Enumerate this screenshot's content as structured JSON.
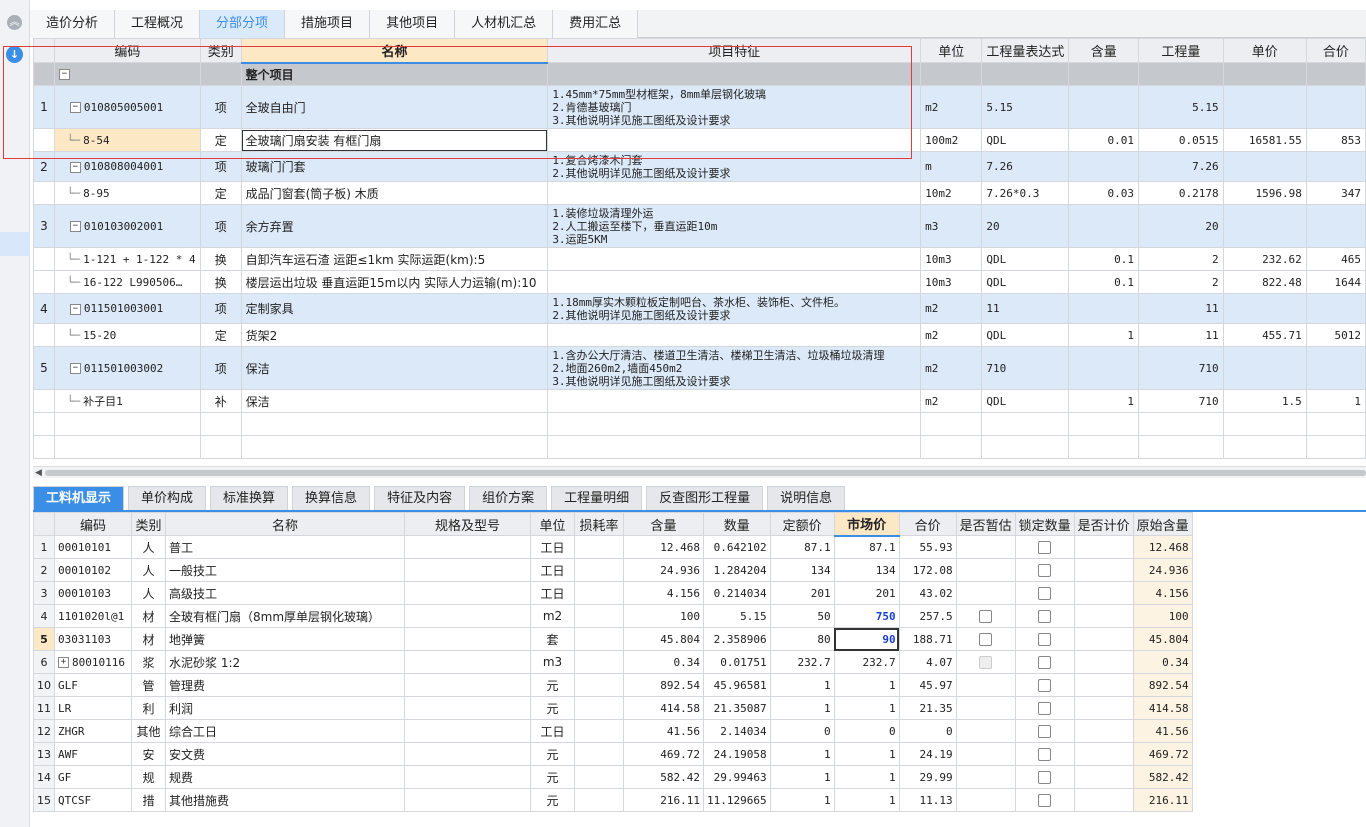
{
  "top_tabs": [
    "造价分析",
    "工程概况",
    "分部分项",
    "措施项目",
    "其他项目",
    "人材机汇总",
    "费用汇总"
  ],
  "top_active": 2,
  "upper_headers": [
    "编码",
    "类别",
    "名称",
    "项目特征",
    "单位",
    "工程量表达式",
    "含量",
    "工程量",
    "单价",
    "合价"
  ],
  "upper_rows": [
    {
      "type": "grp",
      "rn": "",
      "code": "",
      "cat": "",
      "name": "整个项目",
      "feat": "",
      "unit": "",
      "expr": "",
      "qty_ratio": "",
      "qty": "",
      "price": "",
      "total": ""
    },
    {
      "type": "item",
      "rn": "1",
      "code": "010805005001",
      "cat": "项",
      "name": "全玻自由门",
      "feat": "1.45mm*75mm型材框架，8mm单层钢化玻璃\n2.肯德基玻璃门\n3.其他说明详见施工图纸及设计要求",
      "unit": "m2",
      "expr": "5.15",
      "qty_ratio": "",
      "qty": "5.15",
      "price": "",
      "total": ""
    },
    {
      "type": "sub",
      "rn": "",
      "code": "8-54",
      "cat": "定",
      "name": "全玻璃门扇安装 有框门扇",
      "feat": "",
      "unit": "100m2",
      "expr": "QDL",
      "qty_ratio": "0.01",
      "qty": "0.0515",
      "price": "16581.55",
      "total": "853"
    },
    {
      "type": "item",
      "rn": "2",
      "code": "010808004001",
      "cat": "项",
      "name": "玻璃门门套",
      "feat": "1.复合烤漆木门套\n2.其他说明详见施工图纸及设计要求",
      "unit": "m",
      "expr": "7.26",
      "qty_ratio": "",
      "qty": "7.26",
      "price": "",
      "total": ""
    },
    {
      "type": "sub",
      "rn": "",
      "code": "8-95",
      "cat": "定",
      "name": "成品门窗套(筒子板) 木质",
      "feat": "",
      "unit": "10m2",
      "expr": "7.26*0.3",
      "qty_ratio": "0.03",
      "qty": "0.2178",
      "price": "1596.98",
      "total": "347"
    },
    {
      "type": "item",
      "rn": "3",
      "code": "010103002001",
      "cat": "项",
      "name": "余方弃置",
      "feat": "1.装修垃圾清理外运\n2.人工搬运至楼下，垂直运距10m\n3.运距5KM",
      "unit": "m3",
      "expr": "20",
      "qty_ratio": "",
      "qty": "20",
      "price": "",
      "total": ""
    },
    {
      "type": "sub",
      "rn": "",
      "code": "1-121 + 1-122 * 4",
      "cat": "换",
      "name": "自卸汽车运石渣 运距≤1km  实际运距(km):5",
      "feat": "",
      "unit": "10m3",
      "expr": "QDL",
      "qty_ratio": "0.1",
      "qty": "2",
      "price": "232.62",
      "total": "465"
    },
    {
      "type": "sub",
      "rn": "",
      "code": "16-122 L990506…",
      "cat": "换",
      "name": "楼层运出垃圾 垂直运距15m以内  实际人力运输(m):10",
      "feat": "",
      "unit": "10m3",
      "expr": "QDL",
      "qty_ratio": "0.1",
      "qty": "2",
      "price": "822.48",
      "total": "1644"
    },
    {
      "type": "item",
      "rn": "4",
      "code": "011501003001",
      "cat": "项",
      "name": "定制家具",
      "feat": "1.18mm厚实木颗粒板定制吧台、茶水柜、装饰柜、文件柜。\n2.其他说明详见施工图纸及设计要求",
      "unit": "m2",
      "expr": "11",
      "qty_ratio": "",
      "qty": "11",
      "price": "",
      "total": ""
    },
    {
      "type": "sub",
      "rn": "",
      "code": "15-20",
      "cat": "定",
      "name": "货架2",
      "feat": "",
      "unit": "m2",
      "expr": "QDL",
      "qty_ratio": "1",
      "qty": "11",
      "price": "455.71",
      "total": "5012"
    },
    {
      "type": "item",
      "rn": "5",
      "code": "011501003002",
      "cat": "项",
      "name": "保洁",
      "feat": "1.含办公大厅清洁、楼道卫生清洁、楼梯卫生清洁、垃圾桶垃圾清理\n2.地面260m2,墙面450m2\n3.其他说明详见施工图纸及设计要求",
      "unit": "m2",
      "expr": "710",
      "qty_ratio": "",
      "qty": "710",
      "price": "",
      "total": ""
    },
    {
      "type": "sub",
      "rn": "",
      "code": "补子目1",
      "cat": "补",
      "name": "保洁",
      "feat": "",
      "unit": "m2",
      "expr": "QDL",
      "qty_ratio": "1",
      "qty": "710",
      "price": "1.5",
      "total": "1"
    }
  ],
  "bottom_tabs": [
    "工料机显示",
    "单价构成",
    "标准换算",
    "换算信息",
    "特征及内容",
    "组价方案",
    "工程量明细",
    "反查图形工程量",
    "说明信息"
  ],
  "bottom_active": 0,
  "lower_headers": [
    "编码",
    "类别",
    "名称",
    "规格及型号",
    "单位",
    "损耗率",
    "含量",
    "数量",
    "定额价",
    "市场价",
    "合价",
    "是否暂估",
    "锁定数量",
    "是否计价",
    "原始含量"
  ],
  "lower_rows": [
    {
      "rn": "1",
      "code": "00010101",
      "cat": "人",
      "name": "普工",
      "spec": "",
      "unit": "工日",
      "loss": "",
      "ratio": "12.468",
      "qty": "0.642102",
      "base": "87.1",
      "market": "87.1",
      "total": "55.93",
      "est": "",
      "lock": "cb",
      "calc": "",
      "orig": "12.468"
    },
    {
      "rn": "2",
      "code": "00010102",
      "cat": "人",
      "name": "一般技工",
      "spec": "",
      "unit": "工日",
      "loss": "",
      "ratio": "24.936",
      "qty": "1.284204",
      "base": "134",
      "market": "134",
      "total": "172.08",
      "est": "",
      "lock": "cb",
      "calc": "",
      "orig": "24.936"
    },
    {
      "rn": "3",
      "code": "00010103",
      "cat": "人",
      "name": "高级技工",
      "spec": "",
      "unit": "工日",
      "loss": "",
      "ratio": "4.156",
      "qty": "0.214034",
      "base": "201",
      "market": "201",
      "total": "43.02",
      "est": "",
      "lock": "cb",
      "calc": "",
      "orig": "4.156"
    },
    {
      "rn": "4",
      "code": "1101020l@1",
      "cat": "材",
      "name": "全玻有框门扇（8mm厚单层钢化玻璃）",
      "spec": "",
      "unit": "m2",
      "loss": "",
      "ratio": "100",
      "qty": "5.15",
      "base": "50",
      "market": "750",
      "total": "257.5",
      "est": "cb",
      "lock": "cb",
      "calc": "",
      "orig": "100",
      "blue": true
    },
    {
      "rn": "5",
      "code": "03031103",
      "cat": "材",
      "name": "地弹簧",
      "spec": "",
      "unit": "套",
      "loss": "",
      "ratio": "45.804",
      "qty": "2.358906",
      "base": "80",
      "market": "90",
      "total": "188.71",
      "est": "cb",
      "lock": "cb",
      "calc": "",
      "orig": "45.804",
      "blue": true,
      "current": true
    },
    {
      "rn": "6",
      "code": "80010116",
      "cat": "浆",
      "name": "水泥砂浆 1:2",
      "spec": "",
      "unit": "m3",
      "loss": "",
      "ratio": "0.34",
      "qty": "0.01751",
      "base": "232.7",
      "market": "232.7",
      "total": "4.07",
      "est": "cbd",
      "lock": "cb",
      "calc": "",
      "orig": "0.34",
      "expand": true
    },
    {
      "rn": "10",
      "code": "GLF",
      "cat": "管",
      "name": "管理费",
      "spec": "",
      "unit": "元",
      "loss": "",
      "ratio": "892.54",
      "qty": "45.96581",
      "base": "1",
      "market": "1",
      "total": "45.97",
      "est": "",
      "lock": "cb",
      "calc": "",
      "orig": "892.54"
    },
    {
      "rn": "11",
      "code": "LR",
      "cat": "利",
      "name": "利润",
      "spec": "",
      "unit": "元",
      "loss": "",
      "ratio": "414.58",
      "qty": "21.35087",
      "base": "1",
      "market": "1",
      "total": "21.35",
      "est": "",
      "lock": "cb",
      "calc": "",
      "orig": "414.58"
    },
    {
      "rn": "12",
      "code": "ZHGR",
      "cat": "其他",
      "name": "综合工日",
      "spec": "",
      "unit": "工日",
      "loss": "",
      "ratio": "41.56",
      "qty": "2.14034",
      "base": "0",
      "market": "0",
      "total": "0",
      "est": "",
      "lock": "cb",
      "calc": "",
      "orig": "41.56"
    },
    {
      "rn": "13",
      "code": "AWF",
      "cat": "安",
      "name": "安文费",
      "spec": "",
      "unit": "元",
      "loss": "",
      "ratio": "469.72",
      "qty": "24.19058",
      "base": "1",
      "market": "1",
      "total": "24.19",
      "est": "",
      "lock": "cb",
      "calc": "",
      "orig": "469.72"
    },
    {
      "rn": "14",
      "code": "GF",
      "cat": "规",
      "name": "规费",
      "spec": "",
      "unit": "元",
      "loss": "",
      "ratio": "582.42",
      "qty": "29.99463",
      "base": "1",
      "market": "1",
      "total": "29.99",
      "est": "",
      "lock": "cb",
      "calc": "",
      "orig": "582.42"
    },
    {
      "rn": "15",
      "code": "QTCSF",
      "cat": "措",
      "name": "其他措施费",
      "spec": "",
      "unit": "元",
      "loss": "",
      "ratio": "216.11",
      "qty": "11.129665",
      "base": "1",
      "market": "1",
      "total": "11.13",
      "est": "",
      "lock": "cb",
      "calc": "",
      "orig": "216.11"
    }
  ]
}
